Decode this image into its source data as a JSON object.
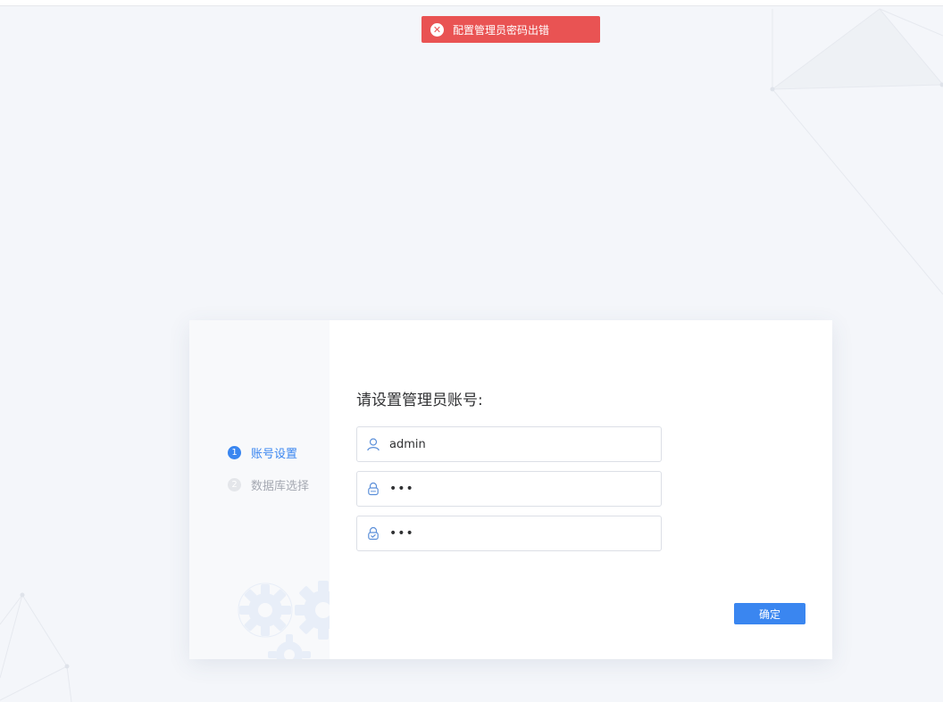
{
  "toast": {
    "message": "配置管理员密码出错",
    "icon": "close-circle-icon",
    "color": "#e95353"
  },
  "steps": [
    {
      "number": "1",
      "label": "账号设置",
      "state": "active"
    },
    {
      "number": "2",
      "label": "数据库选择",
      "state": "inactive"
    }
  ],
  "form": {
    "title": "请设置管理员账号:",
    "username": {
      "value": "admin",
      "icon": "user-icon"
    },
    "password": {
      "value": "123",
      "icon": "lock-icon"
    },
    "confirm_password": {
      "value": "123",
      "icon": "shield-lock-icon"
    },
    "submit_label": "确定"
  },
  "colors": {
    "accent": "#3a86f0",
    "error": "#e95353",
    "background": "#f4f6fa"
  }
}
